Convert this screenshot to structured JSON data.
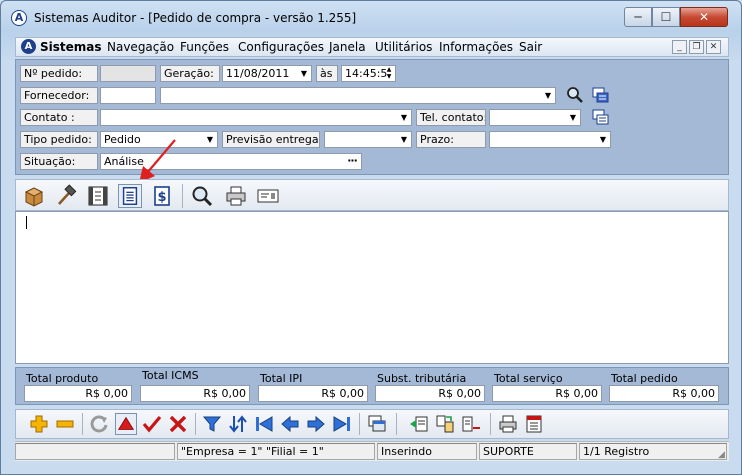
{
  "window": {
    "title": "Sistemas Auditor - [Pedido de compra - versão 1.255]",
    "controls": {
      "minimize": "─",
      "maximize": "☐",
      "close": "✕"
    }
  },
  "menu": {
    "brand": "Sistemas",
    "items": [
      "Navegação",
      "Funções",
      "Configurações",
      "Janela",
      "Utilitários",
      "Informações",
      "Sair"
    ]
  },
  "form": {
    "numero_pedido": {
      "label": "Nº pedido:",
      "value": ""
    },
    "geracao": {
      "label": "Geração:",
      "date": "11/08/2011",
      "as_label": "às",
      "time": "14:45:5"
    },
    "fornecedor": {
      "label": "Fornecedor:",
      "code": "",
      "name": ""
    },
    "contato": {
      "label": "Contato :",
      "value": ""
    },
    "tel_contato": {
      "label": "Tel. contato:",
      "value": ""
    },
    "tipo_pedido": {
      "label": "Tipo pedido:",
      "value": "Pedido"
    },
    "previsao_entrega": {
      "label": "Previsão entrega:",
      "value": ""
    },
    "prazo": {
      "label": "Prazo:",
      "value": ""
    },
    "situacao": {
      "label": "Situação:",
      "value": "Análise"
    }
  },
  "totals": [
    {
      "label": "Total produto",
      "value": "R$ 0,00"
    },
    {
      "label": "Total ICMS",
      "value": "R$ 0,00"
    },
    {
      "label": "Total IPI",
      "value": "R$ 0,00"
    },
    {
      "label": "Subst. tributária",
      "value": "R$ 0,00"
    },
    {
      "label": "Total serviço",
      "value": "R$ 0,00"
    },
    {
      "label": "Total pedido",
      "value": "R$ 0,00"
    }
  ],
  "status": {
    "empresa_filial": "\"Empresa = 1\"   \"Filial = 1\"",
    "mode": "Inserindo",
    "user": "SUPORTE",
    "records": "1/1 Registro"
  },
  "colors": {
    "panel": "#a3b9d6",
    "accent_red": "#e02020"
  }
}
